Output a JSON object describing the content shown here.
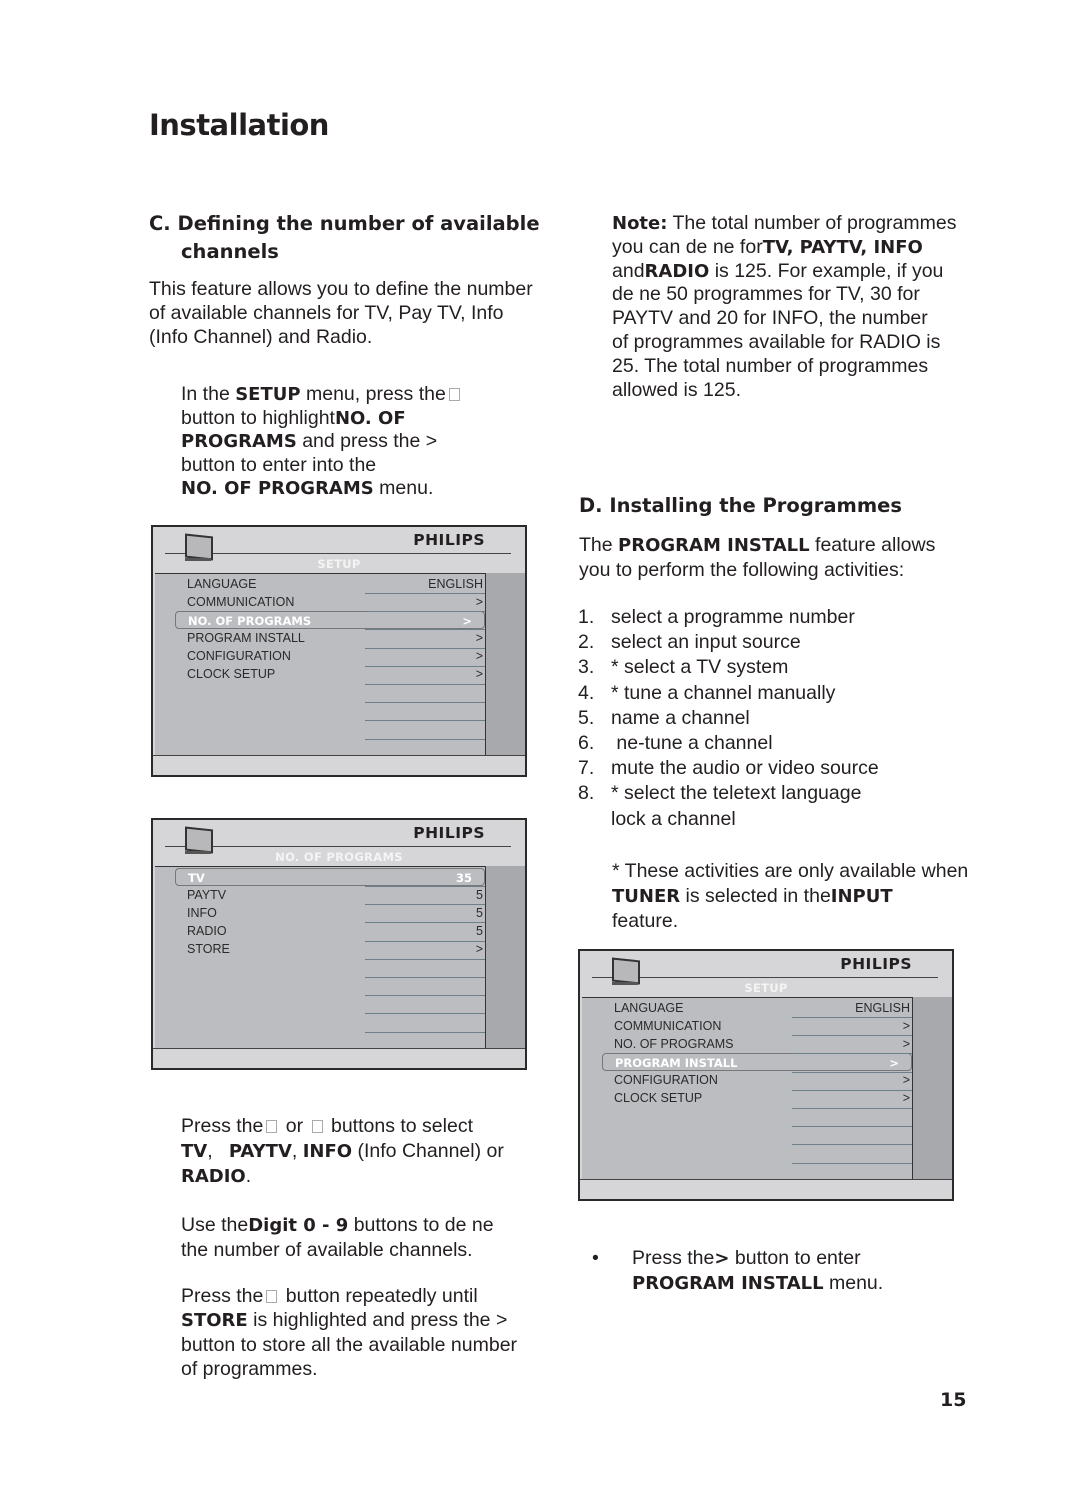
{
  "page": {
    "title": "Installation",
    "page_number": "15"
  },
  "section_c": {
    "heading_line1": "C. Defining the number of available",
    "heading_line2": "channels",
    "intro": [
      "This feature allows you to define the number",
      "of available channels for TV, Pay TV, Info",
      "(Info Channel) and Radio."
    ],
    "step1": {
      "l1a": "In the ",
      "l1b": "SETUP",
      "l1c": " menu, press the",
      "l2a": "button to highlight",
      "l2b": "NO. OF",
      "l3a": "PROGRAMS",
      "l3b": " and press the  >",
      "l4": "button to enter into the",
      "l5a": "NO. OF PROGRAMS",
      "l5b": " menu."
    },
    "step2": {
      "l1a": "Press the",
      "l1b": " or ",
      "l1c": " buttons to select",
      "l2a": "TV",
      "l2b": ",   ",
      "l2c": "PAYTV",
      "l2d": ", ",
      "l2e": "INFO",
      "l2f": " (Info Channel) or",
      "l3a": "RADIO",
      "l3b": "."
    },
    "step3": {
      "l1a": "Use the",
      "l1b": "Digit 0 - 9",
      "l1c": " buttons to de ne",
      "l2": "the number of  available channels."
    },
    "step4": {
      "l1a": "Press the",
      "l1b": " button repeatedly until",
      "l2a": "STORE",
      "l2b": " is highlighted and press the >",
      "l3": "button to store all the available number",
      "l4": "of programmes."
    }
  },
  "note": {
    "l1a": "Note:",
    "l1b": " The total number of programmes",
    "l2a": "you can de ne for",
    "l2b": "TV, PAYTV, INFO",
    "l3a": "and",
    "l3b": "RADIO",
    "l3c": " is 125. For example, if you",
    "l4": "de ne 50 programmes for TV, 30 for",
    "l5": "PAYTV and 20 for INFO, the number",
    "l6": "of programmes available for RADIO is",
    "l7": "25. The total number of programmes",
    "l8": "allowed is 125."
  },
  "section_d": {
    "heading": "D. Installing the Programmes",
    "intro_a": "The ",
    "intro_b": "PROGRAM INSTALL",
    "intro_c": " feature allows",
    "intro_2": "you to perform the following activities:",
    "activities": [
      {
        "n": "1.",
        "text": "select a programme number"
      },
      {
        "n": "2.",
        "text": "select an input source"
      },
      {
        "n": "3.",
        "text": "* select a TV system"
      },
      {
        "n": "4.",
        "text": "* tune a channel manually"
      },
      {
        "n": "5.",
        "text": "name a channel"
      },
      {
        "n": "6.",
        "text": " ne-tune a channel"
      },
      {
        "n": "7.",
        "text": "mute the audio or video source"
      },
      {
        "n": "8.",
        "text": "* select the teletext language"
      },
      {
        "n": "",
        "text": "lock a channel"
      }
    ],
    "footnote_1": "* These activities are only available when",
    "footnote_2a": "TUNER",
    "footnote_2b": " is selected in the",
    "footnote_2c": "INPUT",
    "footnote_3": "feature.",
    "bullet_a": "Press the",
    "bullet_b": ">",
    "bullet_c": " button to enter",
    "bullet_2a": "PROGRAM INSTALL",
    "bullet_2b": " menu."
  },
  "menus": [
    {
      "brand": "PHILIPS",
      "title": "SETUP",
      "rows": [
        {
          "label": "LANGUAGE",
          "value": "ENGLISH",
          "highlighted": false
        },
        {
          "label": "COMMUNICATION",
          "value": ">",
          "highlighted": false
        },
        {
          "label": "NO. OF PROGRAMS",
          "value": ">",
          "highlighted": true
        },
        {
          "label": "PROGRAM INSTALL",
          "value": ">",
          "highlighted": false
        },
        {
          "label": "CONFIGURATION",
          "value": ">",
          "highlighted": false
        },
        {
          "label": "CLOCK SETUP",
          "value": ">",
          "highlighted": false
        }
      ]
    },
    {
      "brand": "PHILIPS",
      "title": "NO. OF PROGRAMS",
      "rows": [
        {
          "label": "TV",
          "value": "35",
          "highlighted": true
        },
        {
          "label": "PAYTV",
          "value": "5",
          "highlighted": false
        },
        {
          "label": "INFO",
          "value": "5",
          "highlighted": false
        },
        {
          "label": "RADIO",
          "value": "5",
          "highlighted": false
        },
        {
          "label": "STORE",
          "value": ">",
          "highlighted": false
        }
      ]
    },
    {
      "brand": "PHILIPS",
      "title": "SETUP",
      "rows": [
        {
          "label": "LANGUAGE",
          "value": "ENGLISH",
          "highlighted": false
        },
        {
          "label": "COMMUNICATION",
          "value": ">",
          "highlighted": false
        },
        {
          "label": "NO. OF PROGRAMS",
          "value": ">",
          "highlighted": false
        },
        {
          "label": "PROGRAM INSTALL",
          "value": ">",
          "highlighted": true
        },
        {
          "label": "CONFIGURATION",
          "value": ">",
          "highlighted": false
        },
        {
          "label": "CLOCK SETUP",
          "value": ">",
          "highlighted": false
        }
      ]
    }
  ]
}
